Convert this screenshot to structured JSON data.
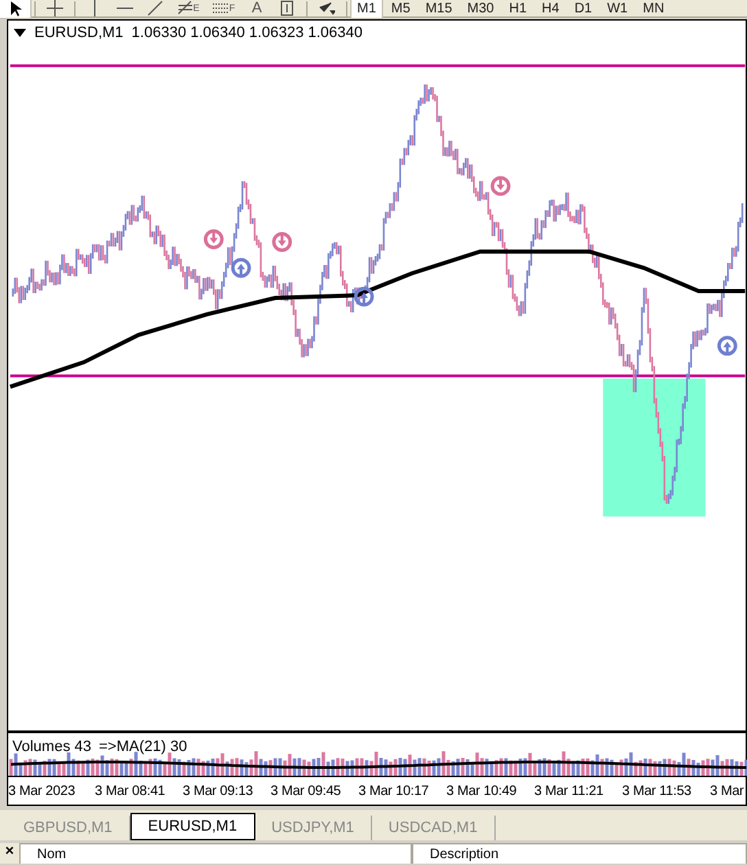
{
  "toolbar": {
    "tools": [
      {
        "kind": "cursor",
        "selected": true
      },
      {
        "kind": "crosshair",
        "selected": false
      },
      {
        "kind": "vline",
        "selected": false
      },
      {
        "kind": "hline",
        "selected": false
      },
      {
        "kind": "trend",
        "selected": false
      },
      {
        "kind": "fibo",
        "label": "E",
        "selected": false
      },
      {
        "kind": "fibolines",
        "label": "F",
        "selected": false
      },
      {
        "kind": "text",
        "label": "A",
        "selected": false
      },
      {
        "kind": "textlabel",
        "selected": false
      },
      {
        "kind": "arrows",
        "selected": false
      }
    ],
    "timeframes": [
      {
        "label": "M1",
        "selected": true
      },
      {
        "label": "M5",
        "selected": false
      },
      {
        "label": "M15",
        "selected": false
      },
      {
        "label": "M30",
        "selected": false
      },
      {
        "label": "H1",
        "selected": false
      },
      {
        "label": "H4",
        "selected": false
      },
      {
        "label": "D1",
        "selected": false
      },
      {
        "label": "W1",
        "selected": false
      },
      {
        "label": "MN",
        "selected": false
      }
    ]
  },
  "chart": {
    "symbol": "EURUSD,M1",
    "prices": "1.06330 1.06340 1.06323 1.06340",
    "volume_label": "Volumes 43",
    "volume_ma": "=>MA(21) 30",
    "time_labels": [
      "3 Mar 2023",
      "3 Mar 08:41",
      "3 Mar 09:13",
      "3 Mar 09:45",
      "3 Mar 10:17",
      "3 Mar 10:49",
      "3 Mar 11:21",
      "3 Mar 11:53",
      "3 Mar"
    ]
  },
  "tabs": [
    {
      "label": "GBPUSD,M1",
      "selected": false
    },
    {
      "label": "EURUSD,M1",
      "selected": true
    },
    {
      "label": "USDJPY,M1",
      "selected": false
    },
    {
      "label": "USDCAD,M1",
      "selected": false
    }
  ],
  "bottom_panel": {
    "close": "×",
    "columns": [
      "Nom",
      "Description"
    ]
  }
}
